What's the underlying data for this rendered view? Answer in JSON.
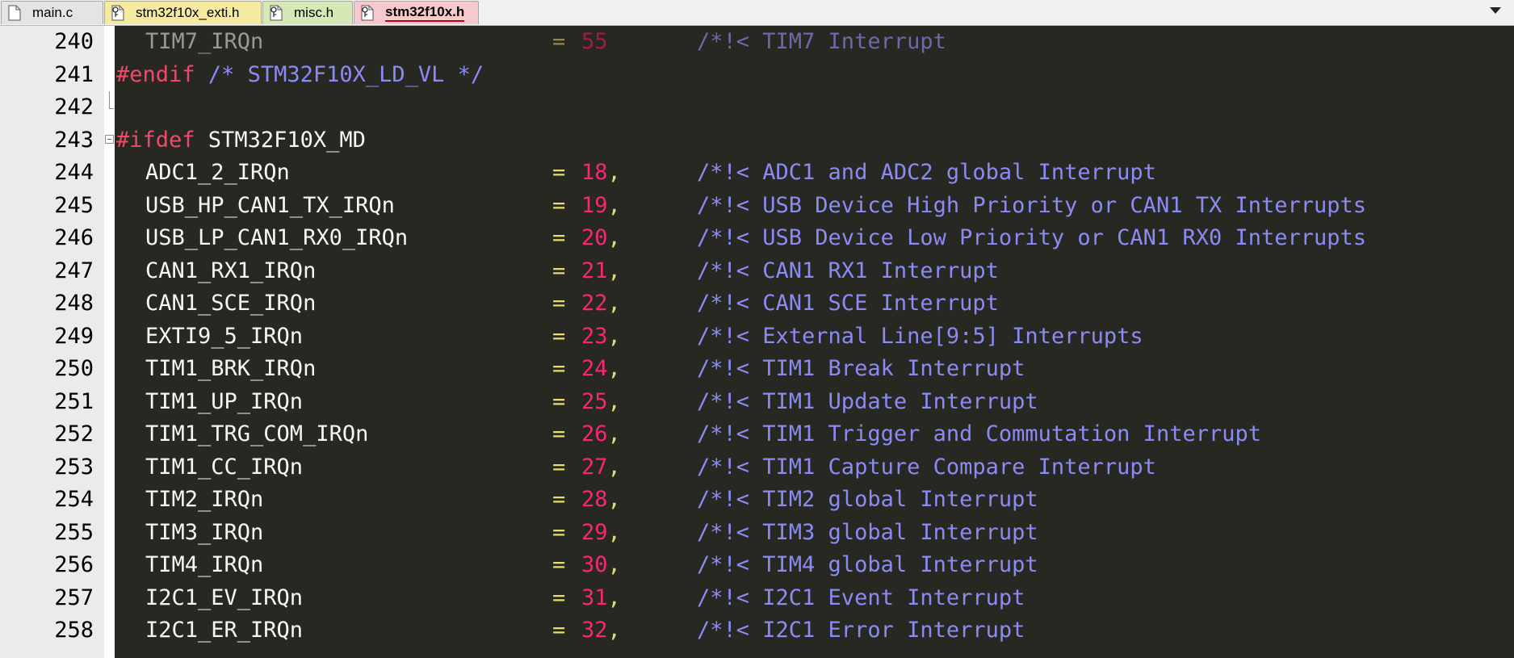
{
  "tabs": [
    {
      "label": "main.c",
      "icon": "c-file-icon",
      "color": "#e4e4e4",
      "active": false
    },
    {
      "label": "stm32f10x_exti.h",
      "icon": "header-file-icon",
      "color": "#f5eaa0",
      "active": false
    },
    {
      "label": "misc.h",
      "icon": "header-file-icon",
      "color": "#d6e8b6",
      "active": false
    },
    {
      "label": "stm32f10x.h",
      "icon": "header-file-icon",
      "color": "#f7c8cc",
      "active": true
    }
  ],
  "colors": {
    "background": "#272822",
    "identifier": "#f8f8f2",
    "number": "#f92672",
    "operator": "#e6db74",
    "comment": "#8b8bf5",
    "preprocessor": "#f04a6a"
  },
  "lines": [
    {
      "n": "240",
      "ident": "TIM7_IRQn",
      "eq": "=",
      "num": "55",
      "comma": "",
      "comment": "/*!< TIM7 Interrupt",
      "dim": true
    },
    {
      "n": "241",
      "directive": "#endif",
      "rest": " /* STM32F10X_LD_VL */",
      "restIsComment": true
    },
    {
      "n": "242"
    },
    {
      "n": "243",
      "directive": "#ifdef",
      "rest": " STM32F10X_MD",
      "restIsComment": false,
      "fold": "box"
    },
    {
      "n": "244",
      "ident": "ADC1_2_IRQn",
      "eq": "=",
      "num": "18",
      "comma": ",",
      "comment": "/*!< ADC1 and ADC2 global Interrupt"
    },
    {
      "n": "245",
      "ident": "USB_HP_CAN1_TX_IRQn",
      "eq": "=",
      "num": "19",
      "comma": ",",
      "comment": "/*!< USB Device High Priority or CAN1 TX Interrupts"
    },
    {
      "n": "246",
      "ident": "USB_LP_CAN1_RX0_IRQn",
      "eq": "=",
      "num": "20",
      "comma": ",",
      "comment": "/*!< USB Device Low Priority or CAN1 RX0 Interrupts"
    },
    {
      "n": "247",
      "ident": "CAN1_RX1_IRQn",
      "eq": "=",
      "num": "21",
      "comma": ",",
      "comment": "/*!< CAN1 RX1 Interrupt"
    },
    {
      "n": "248",
      "ident": "CAN1_SCE_IRQn",
      "eq": "=",
      "num": "22",
      "comma": ",",
      "comment": "/*!< CAN1 SCE Interrupt"
    },
    {
      "n": "249",
      "ident": "EXTI9_5_IRQn",
      "eq": "=",
      "num": "23",
      "comma": ",",
      "comment": "/*!< External Line[9:5] Interrupts"
    },
    {
      "n": "250",
      "ident": "TIM1_BRK_IRQn",
      "eq": "=",
      "num": "24",
      "comma": ",",
      "comment": "/*!< TIM1 Break Interrupt"
    },
    {
      "n": "251",
      "ident": "TIM1_UP_IRQn",
      "eq": "=",
      "num": "25",
      "comma": ",",
      "comment": "/*!< TIM1 Update Interrupt"
    },
    {
      "n": "252",
      "ident": "TIM1_TRG_COM_IRQn",
      "eq": "=",
      "num": "26",
      "comma": ",",
      "comment": "/*!< TIM1 Trigger and Commutation Interrupt"
    },
    {
      "n": "253",
      "ident": "TIM1_CC_IRQn",
      "eq": "=",
      "num": "27",
      "comma": ",",
      "comment": "/*!< TIM1 Capture Compare Interrupt"
    },
    {
      "n": "254",
      "ident": "TIM2_IRQn",
      "eq": "=",
      "num": "28",
      "comma": ",",
      "comment": "/*!< TIM2 global Interrupt"
    },
    {
      "n": "255",
      "ident": "TIM3_IRQn",
      "eq": "=",
      "num": "29",
      "comma": ",",
      "comment": "/*!< TIM3 global Interrupt"
    },
    {
      "n": "256",
      "ident": "TIM4_IRQn",
      "eq": "=",
      "num": "30",
      "comma": ",",
      "comment": "/*!< TIM4 global Interrupt"
    },
    {
      "n": "257",
      "ident": "I2C1_EV_IRQn",
      "eq": "=",
      "num": "31",
      "comma": ",",
      "comment": "/*!< I2C1 Event Interrupt"
    },
    {
      "n": "258",
      "ident": "I2C1_ER_IRQn",
      "eq": "=",
      "num": "32",
      "comma": ",",
      "comment": "/*!< I2C1 Error Interrupt"
    }
  ]
}
